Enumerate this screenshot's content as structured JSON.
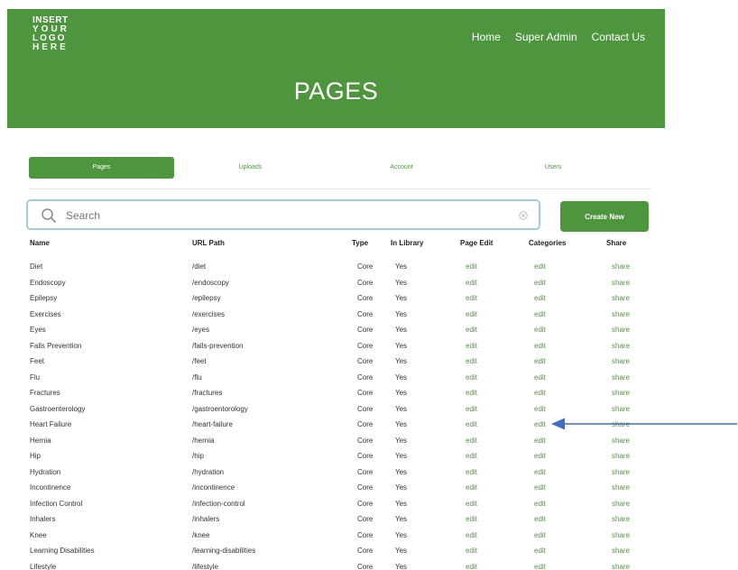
{
  "header": {
    "logo_lines": [
      "INSERT",
      "YOUR",
      "LOGO",
      "HERE"
    ],
    "nav": [
      "Home",
      "Super Admin",
      "Contact Us"
    ],
    "title": "PAGES",
    "bg_color": "#4e963e"
  },
  "tabs": [
    {
      "label": "Pages",
      "active": true
    },
    {
      "label": "Uploads",
      "active": false
    },
    {
      "label": "Account",
      "active": false
    },
    {
      "label": "Users",
      "active": false
    }
  ],
  "search": {
    "placeholder": "Search",
    "value": ""
  },
  "create_button": "Create New",
  "table": {
    "columns": [
      "Name",
      "URL Path",
      "Type",
      "In Library",
      "Page Edit",
      "Categories",
      "Share"
    ],
    "rows": [
      [
        "Diet",
        "/diet",
        "Core",
        "Yes",
        "edit",
        "edit",
        "share"
      ],
      [
        "Endoscopy",
        "/endoscopy",
        "Core",
        "Yes",
        "edit",
        "edit",
        "share"
      ],
      [
        "Epilepsy",
        "/epilepsy",
        "Core",
        "Yes",
        "edit",
        "edit",
        "share"
      ],
      [
        "Exercises",
        "/exercises",
        "Core",
        "Yes",
        "edit",
        "edit",
        "share"
      ],
      [
        "Eyes",
        "/eyes",
        "Core",
        "Yes",
        "edit",
        "edit",
        "share"
      ],
      [
        "Falls Prevention",
        "/falls-prevention",
        "Core",
        "Yes",
        "edit",
        "edit",
        "share"
      ],
      [
        "Feet",
        "/feet",
        "Core",
        "Yes",
        "edit",
        "edit",
        "share"
      ],
      [
        "Flu",
        "/flu",
        "Core",
        "Yes",
        "edit",
        "edit",
        "share"
      ],
      [
        "Fractures",
        "/fractures",
        "Core",
        "Yes",
        "edit",
        "edit",
        "share"
      ],
      [
        "Gastroenterology",
        "/gastroentorology",
        "Core",
        "Yes",
        "edit",
        "edit",
        "share"
      ],
      [
        "Heart Failure",
        "/heart-failure",
        "Core",
        "Yes",
        "edit",
        "edit",
        "share"
      ],
      [
        "Hernia",
        "/hernia",
        "Core",
        "Yes",
        "edit",
        "edit",
        "share"
      ],
      [
        "Hip",
        "/hip",
        "Core",
        "Yes",
        "edit",
        "edit",
        "share"
      ],
      [
        "Hydration",
        "/hydration",
        "Core",
        "Yes",
        "edit",
        "edit",
        "share"
      ],
      [
        "Incontinence",
        "/incontinence",
        "Core",
        "Yes",
        "edit",
        "edit",
        "share"
      ],
      [
        "Infection Control",
        "/infection-control",
        "Core",
        "Yes",
        "edit",
        "edit",
        "share"
      ],
      [
        "Inhalers",
        "/inhalers",
        "Core",
        "Yes",
        "edit",
        "edit",
        "share"
      ],
      [
        "Knee",
        "/knee",
        "Core",
        "Yes",
        "edit",
        "edit",
        "share"
      ],
      [
        "Learning Disabilities",
        "/learning-disabilities",
        "Core",
        "Yes",
        "edit",
        "edit",
        "share"
      ],
      [
        "Lifestyle",
        "/lifestyle",
        "Core",
        "Yes",
        "edit",
        "edit",
        "share"
      ]
    ]
  },
  "colors": {
    "accent": "#4e963e",
    "search_border": "#9ecde3",
    "annotation_arrow": "#3f6fbf"
  },
  "icons": {
    "search": "search-icon",
    "clear": "clear-icon",
    "annotation": "arrow-icon"
  }
}
